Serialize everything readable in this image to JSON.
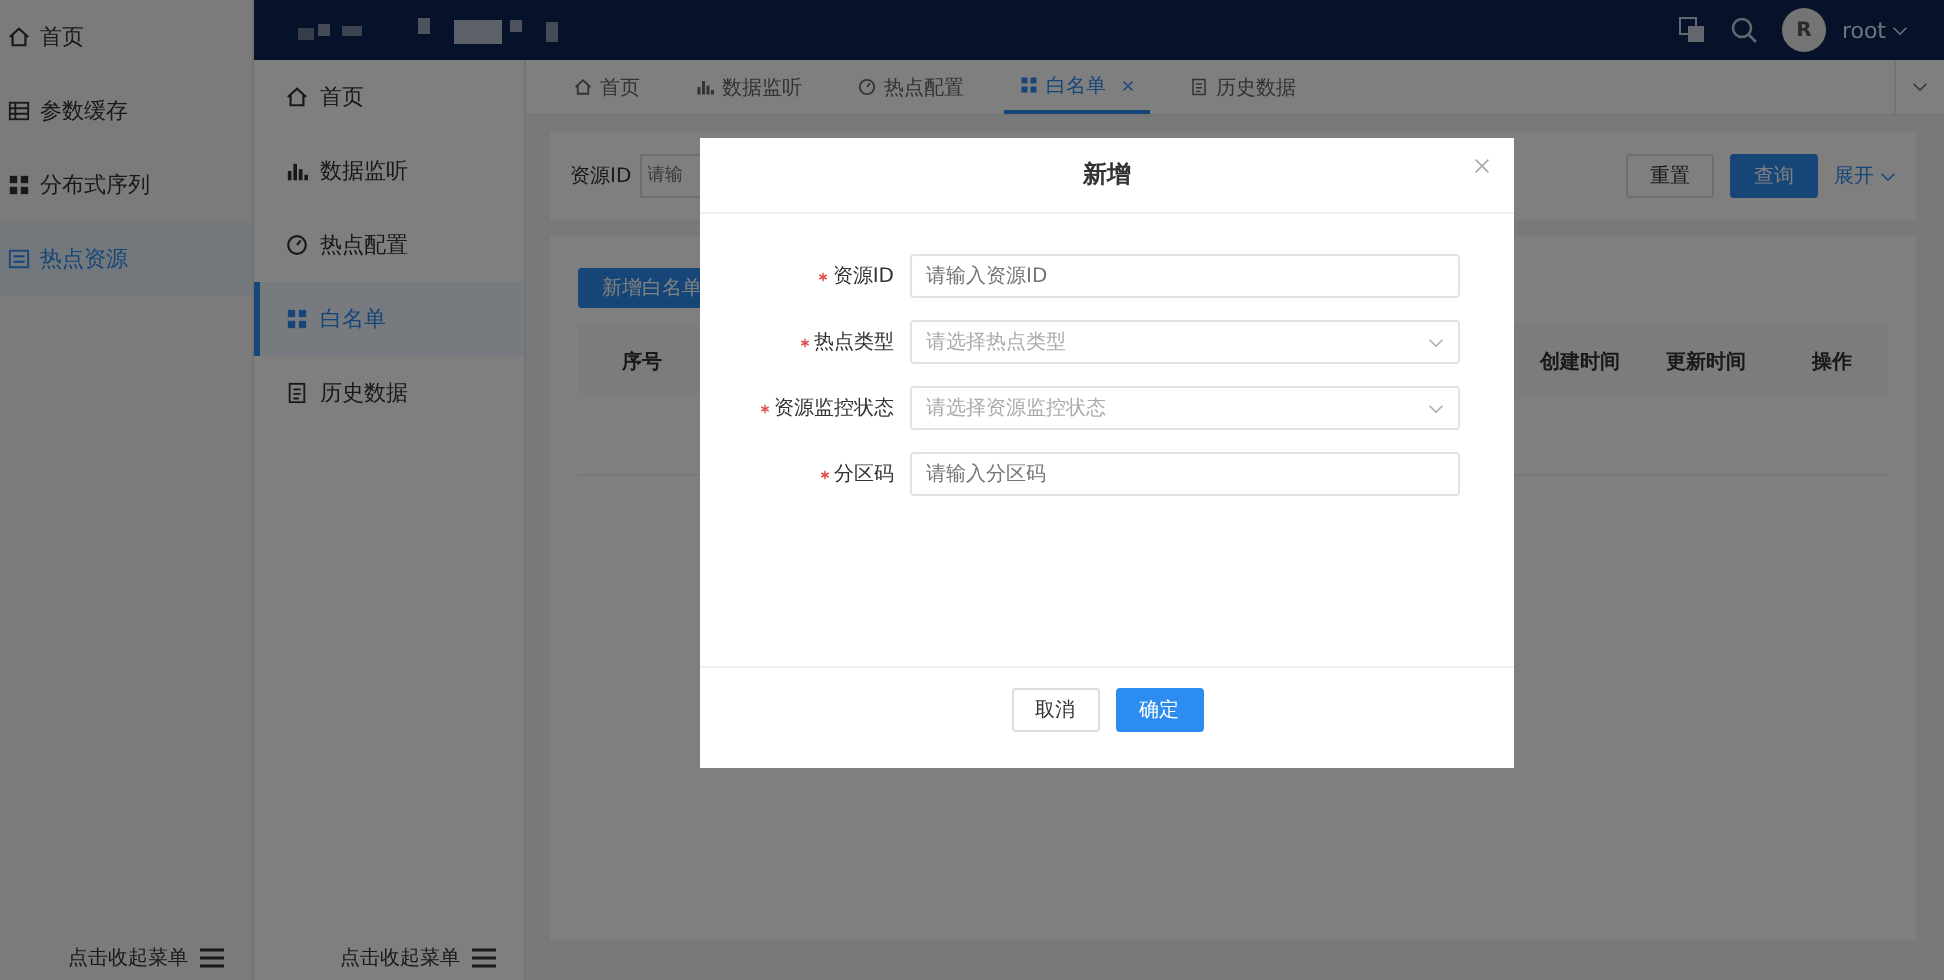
{
  "outer_sidebar": {
    "items": [
      {
        "label": "首页",
        "selected": false
      },
      {
        "label": "参数缓存",
        "selected": false
      },
      {
        "label": "分布式序列",
        "selected": false
      },
      {
        "label": "热点资源",
        "selected": true
      }
    ],
    "collapse": "点击收起菜单"
  },
  "header": {
    "avatar": "R",
    "user": "root"
  },
  "nav_sidebar": {
    "items": [
      {
        "label": "首页",
        "selected": false
      },
      {
        "label": "数据监听",
        "selected": false
      },
      {
        "label": "热点配置",
        "selected": false
      },
      {
        "label": "白名单",
        "selected": true
      },
      {
        "label": "历史数据",
        "selected": false
      }
    ],
    "collapse": "点击收起菜单"
  },
  "tabs": [
    {
      "label": "首页",
      "selected": false
    },
    {
      "label": "数据监听",
      "selected": false
    },
    {
      "label": "热点配置",
      "selected": false
    },
    {
      "label": "白名单",
      "selected": true
    },
    {
      "label": "历史数据",
      "selected": false
    }
  ],
  "search": {
    "label": "资源ID",
    "placeholder": "请输",
    "buttons": [
      {
        "label": "重置",
        "kind": "default"
      },
      {
        "label": "查询",
        "kind": "primary"
      }
    ],
    "expand": "展开"
  },
  "table": {
    "add_button": "新增白名单",
    "columns": [
      "序号",
      "创建时间",
      "更新时间",
      "操作"
    ]
  },
  "dialog": {
    "title": "新增",
    "fields": [
      {
        "label": "资源ID",
        "required": true,
        "kind": "input",
        "placeholder": "请输入资源ID"
      },
      {
        "label": "热点类型",
        "required": true,
        "kind": "select",
        "placeholder": "请选择热点类型"
      },
      {
        "label": "资源监控状态",
        "required": true,
        "kind": "select",
        "placeholder": "请选择资源监控状态"
      },
      {
        "label": "分区码",
        "required": true,
        "kind": "input",
        "placeholder": "请输入分区码"
      }
    ],
    "buttons": [
      {
        "label": "取消",
        "kind": "default"
      },
      {
        "label": "确定",
        "kind": "primary"
      }
    ]
  }
}
